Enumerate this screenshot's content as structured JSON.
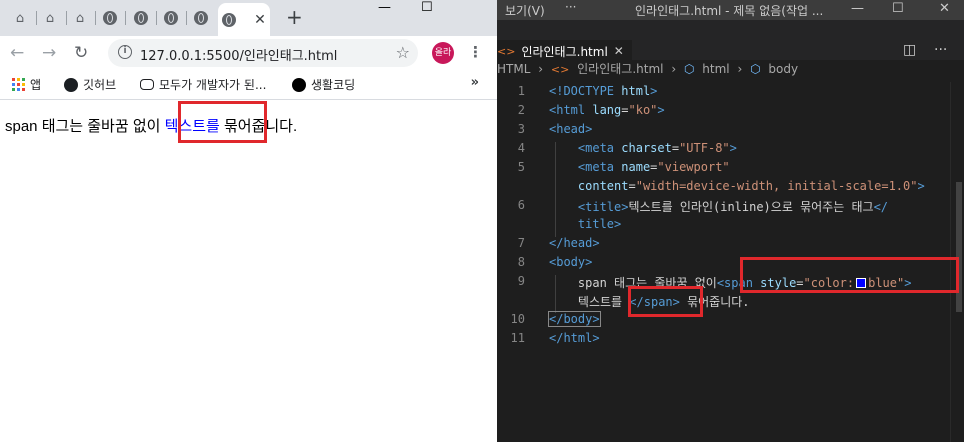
{
  "browser": {
    "tabs": [
      "home",
      "home",
      "home",
      "globe",
      "globe",
      "globe",
      "globe",
      "globe"
    ],
    "active_tab_close": "✕",
    "new_tab": "+",
    "window_controls": [
      "—",
      "☐"
    ],
    "url": "127.0.0.1:5500/인라인태그.html",
    "profile_label": "올라",
    "bookmarks": [
      {
        "label": "앱",
        "icon": "apps-grid-icon"
      },
      {
        "label": "깃허브",
        "icon": "github-icon"
      },
      {
        "label": "모두가 개발자가 된...",
        "icon": "cloud-icon"
      },
      {
        "label": "생활코딩",
        "icon": "black-circle-icon"
      }
    ],
    "bookmarks_overflow": "»",
    "page": {
      "text_before": "span 태그는 줄바꿈 없이 ",
      "text_span": "텍스트를",
      "text_after": " 묶어줍니다."
    }
  },
  "editor": {
    "title_menu": "보기(V)",
    "title_more": "···",
    "window_title": "인라인태그.html - 제목 없음(작업 ...",
    "window_controls": [
      "—",
      "☐",
      "✕"
    ],
    "tab_label": "인라인태그.html",
    "tab_close": "✕",
    "actions": [
      "◫",
      "···"
    ],
    "breadcrumb": [
      "HTML",
      "인라인태그.html",
      "html",
      "body"
    ],
    "lines": [
      {
        "n": "1"
      },
      {
        "n": "2"
      },
      {
        "n": "3"
      },
      {
        "n": "4"
      },
      {
        "n": "5"
      },
      {
        "n": "6"
      },
      {
        "n": "7"
      },
      {
        "n": "8"
      },
      {
        "n": "9"
      },
      {
        "n": "10"
      },
      {
        "n": "11"
      }
    ],
    "code": {
      "l1_doctype": "<!DOCTYPE",
      "l1_html": "html",
      "l2_open": "<html",
      "l2_attr": "lang",
      "l2_val": "\"ko\"",
      "l3": "<head>",
      "l4_meta": "<meta",
      "l4_attr": "charset",
      "l4_val": "\"UTF-8\"",
      "l5_meta": "<meta",
      "l5_attr": "name",
      "l5_val": "\"viewport\"",
      "l5b_attr": "content",
      "l5b_val": "\"width=device-width, initial-scale=1.0\"",
      "l6_title": "<title>",
      "l6_text": "텍스트를 인라인(inline)으로 묶어주는 태그",
      "l6_close_a": "</",
      "l6_close_b": "title>",
      "l7": "</head>",
      "l8": "<body>",
      "l9_text": "span 태그는 줄바꿈 없이",
      "l9_span": "<span",
      "l9_attr": "style",
      "l9_val_a": "\"color:",
      "l9_val_b": "blue\"",
      "l9_close": ">",
      "l9b_text": "텍스트를 ",
      "l9b_endspan": "</span>",
      "l9b_tail": " 묶어줍니다.",
      "l10": "</body>",
      "l11": "</html>"
    }
  },
  "colors": {
    "highlight_box": "#e0282c",
    "span_text": "#0000ff",
    "tag": "#569cd6",
    "attribute": "#9cdcfe",
    "string": "#ce9178"
  }
}
